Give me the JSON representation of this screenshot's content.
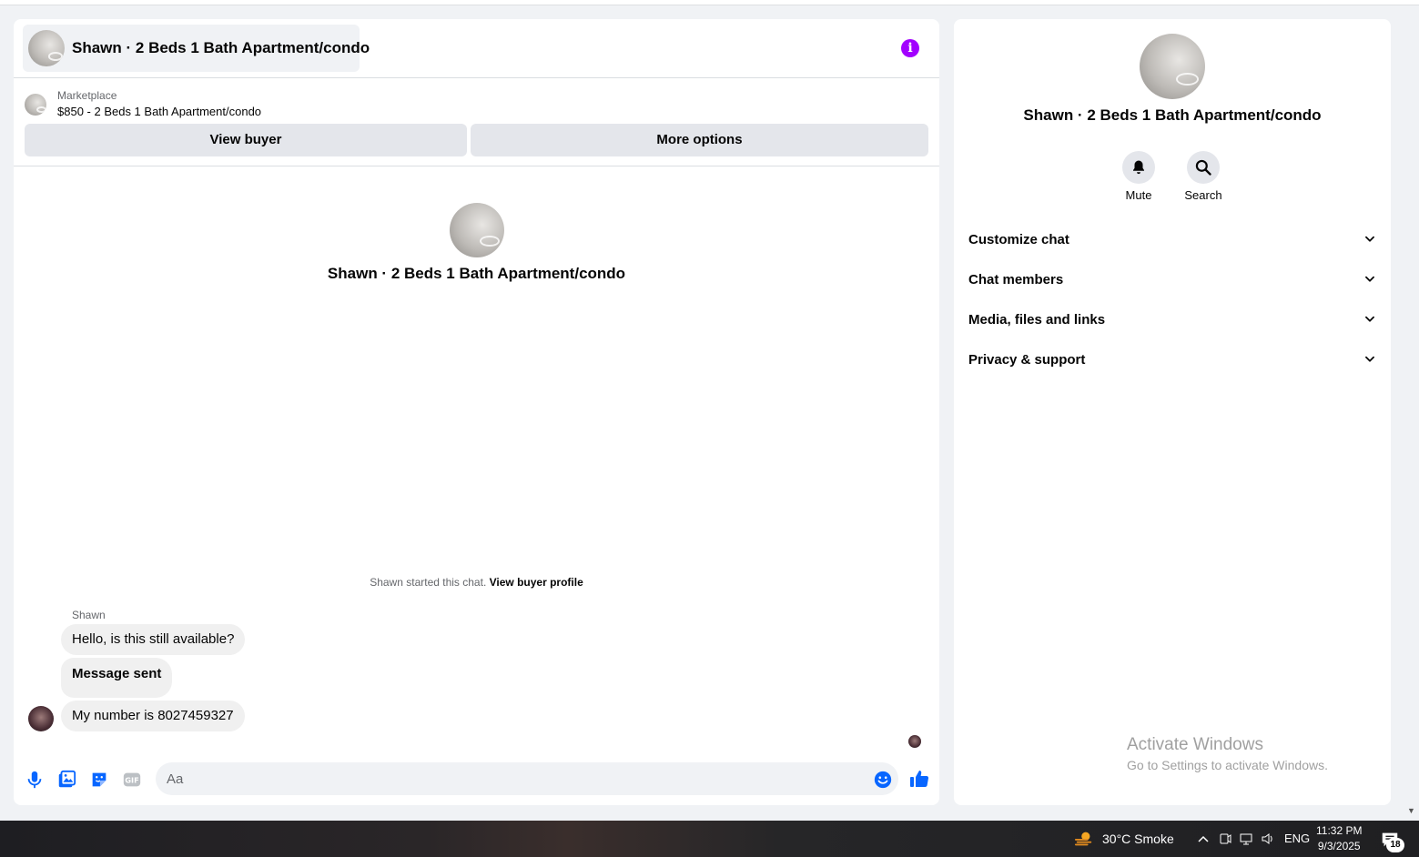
{
  "conversation": {
    "title": "Shawn · 2 Beds 1 Bath Apartment/condo",
    "marketplace_label": "Marketplace",
    "listing": "$850 - 2 Beds 1 Bath Apartment/condo",
    "view_buyer_label": "View buyer",
    "more_options_label": "More options",
    "started_text": "Shawn started this chat.",
    "view_buyer_profile": "View buyer profile"
  },
  "messages": {
    "sender": "Shawn",
    "items": [
      {
        "text": "Hello, is this still available?"
      },
      {
        "text": "Message sent"
      },
      {
        "text": "My number is 8027459327"
      }
    ]
  },
  "composer": {
    "placeholder": "Aa",
    "icons": [
      "microphone-icon",
      "photo-icon",
      "sticker-icon",
      "gif-icon",
      "emoji-icon",
      "like-icon"
    ],
    "accent_color": "#0866ff"
  },
  "details_panel": {
    "title": "Shawn · 2 Beds 1 Bath Apartment/condo",
    "mute_label": "Mute",
    "search_label": "Search",
    "sections": [
      {
        "label": "Customize chat"
      },
      {
        "label": "Chat members"
      },
      {
        "label": "Media, files and links"
      },
      {
        "label": "Privacy & support"
      }
    ]
  },
  "watermark": {
    "line1": "Activate Windows",
    "line2": "Go to Settings to activate Windows."
  },
  "taskbar": {
    "weather": "30°C  Smoke",
    "language": "ENG",
    "time": "11:32 PM",
    "date": "9/3/2025",
    "notification_count": "18"
  },
  "colors": {
    "info_icon": "#a200ff",
    "button_bg": "#e4e6eb",
    "bubble_bg": "#f0f0f0"
  }
}
